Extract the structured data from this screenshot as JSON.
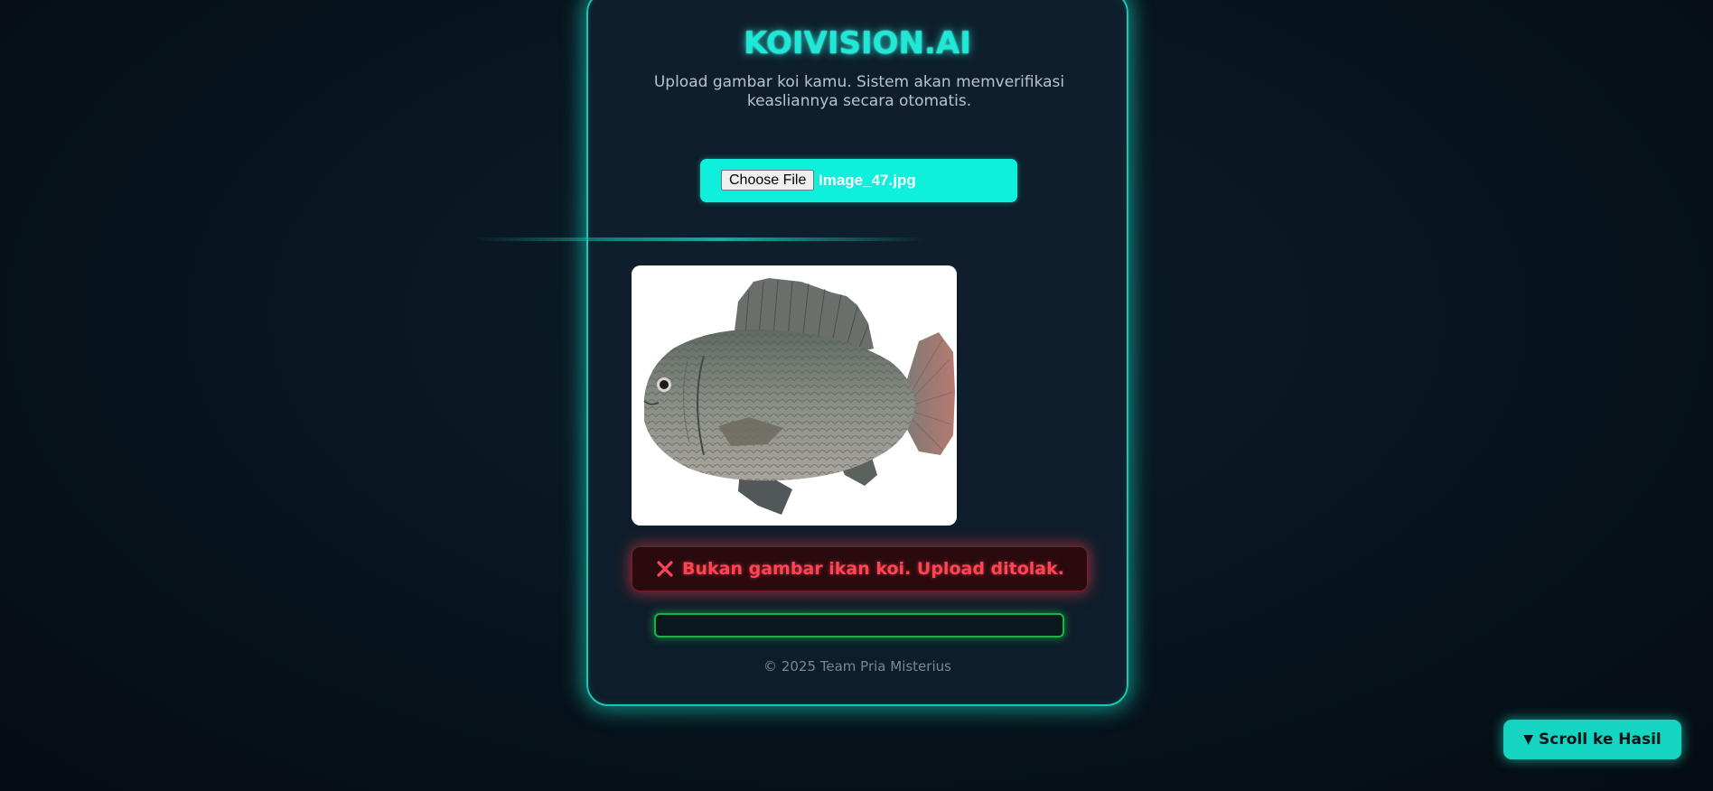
{
  "app": {
    "title": "KOIVISION.AI",
    "subtitle": "Upload gambar koi kamu. Sistem akan memverifikasi keasliannya secara otomatis."
  },
  "upload": {
    "choose_label": "Choose File",
    "file_name": "Image_47.jpg"
  },
  "preview": {
    "image_icon": "fish-image"
  },
  "alert": {
    "icon": "cross-icon",
    "text": "Bukan gambar ikan koi. Upload ditolak."
  },
  "result": {
    "text": ""
  },
  "footer": {
    "text": "© 2025 Team Pria Misterius"
  },
  "scroll_button": {
    "arrow": "▼",
    "label": "Scroll ke Hasil"
  },
  "colors": {
    "accent": "#21e8d6",
    "file_box": "#0ef0dc",
    "error": "#ff4553",
    "success_border": "#19b24a",
    "card_bg": "#0f1e2c"
  }
}
